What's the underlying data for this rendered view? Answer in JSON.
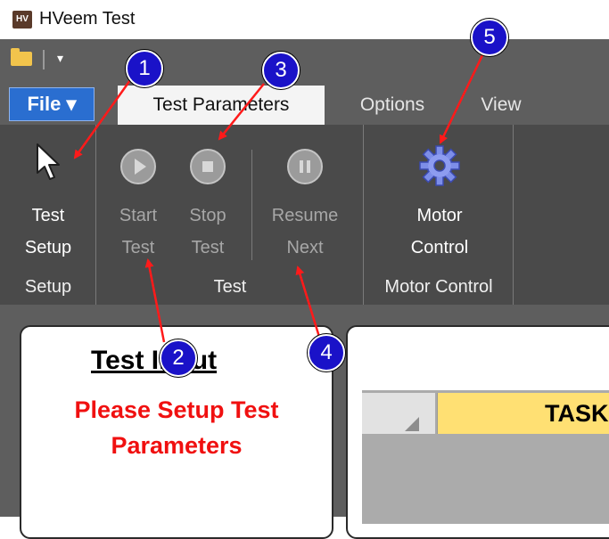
{
  "window": {
    "app_icon": "HV",
    "title": "HVeem Test"
  },
  "quick_access": {
    "folder_icon": "open-folder-icon",
    "dropdown_icon": "customize-dropdown-icon"
  },
  "tabs": {
    "file": "File ▾",
    "items": [
      "Test Parameters",
      "Options",
      "View"
    ]
  },
  "ribbon": {
    "groups": [
      {
        "label": "Setup",
        "buttons": [
          {
            "line1": "Test",
            "line2": "Setup",
            "icon": "arrow-cursor-icon",
            "enabled": true
          }
        ]
      },
      {
        "label": "Test",
        "buttons": [
          {
            "line1": "Start",
            "line2": "Test",
            "icon": "play-icon",
            "enabled": false
          },
          {
            "line1": "Stop",
            "line2": "Test",
            "icon": "stop-icon",
            "enabled": false
          },
          {
            "line1": "Resume",
            "line2": "Next",
            "icon": "pause-icon",
            "enabled": false
          }
        ]
      },
      {
        "label": "Motor Control",
        "buttons": [
          {
            "line1": "Motor",
            "line2": "Control",
            "icon": "gear-icon",
            "enabled": true
          }
        ]
      }
    ]
  },
  "test_input": {
    "title": "Test Input",
    "message_line1": "Please Setup Test",
    "message_line2": "Parameters"
  },
  "grid": {
    "column_header": "TASK"
  },
  "callouts": [
    "1",
    "2",
    "3",
    "4",
    "5"
  ],
  "colors": {
    "callout": "#1a12c8",
    "arrow": "#ff1a1a",
    "message": "#f01010",
    "file_tab": "#2a6ed0",
    "task_header": "#ffe073"
  }
}
